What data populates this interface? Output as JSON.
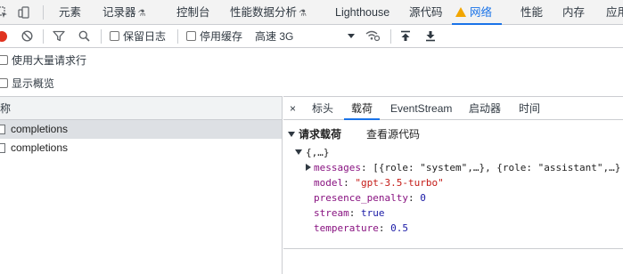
{
  "top_tabs": [
    {
      "label": "元素"
    },
    {
      "label": "记录器"
    },
    {
      "label": "控制台"
    },
    {
      "label": "性能数据分析"
    },
    {
      "label": "Lighthouse"
    },
    {
      "label": "源代码"
    },
    {
      "label": "网络"
    },
    {
      "label": "性能"
    },
    {
      "label": "内存"
    },
    {
      "label": "应用"
    }
  ],
  "flask_glyph": "⚗",
  "toolbar": {
    "preserve_log": "保留日志",
    "disable_cache": "停用缓存",
    "throttling": "高速 3G"
  },
  "options": {
    "big_rows": "使用大量请求行",
    "overview": "显示概览"
  },
  "request_list": {
    "header": "名称",
    "rows": [
      "completions",
      "completions"
    ]
  },
  "detail_tabs": {
    "close": "×",
    "headers": "标头",
    "payload": "载荷",
    "eventstream": "EventStream",
    "initiator": "启动器",
    "timing": "时间"
  },
  "payload": {
    "section_title": "请求载荷",
    "view_source": "查看源代码",
    "root": "{,…}",
    "lines": [
      {
        "key": "messages",
        "value": "[{role: \"system\",…}, {role: \"assistant\",…}"
      },
      {
        "key": "model",
        "value": "\"gpt-3.5-turbo\""
      },
      {
        "key": "presence_penalty",
        "value": "0"
      },
      {
        "key": "stream",
        "value": "true"
      },
      {
        "key": "temperature",
        "value": "0.5"
      }
    ]
  },
  "colors": {
    "accent": "#1a73e8",
    "record": "#e0321f",
    "warning": "#f2a600"
  }
}
